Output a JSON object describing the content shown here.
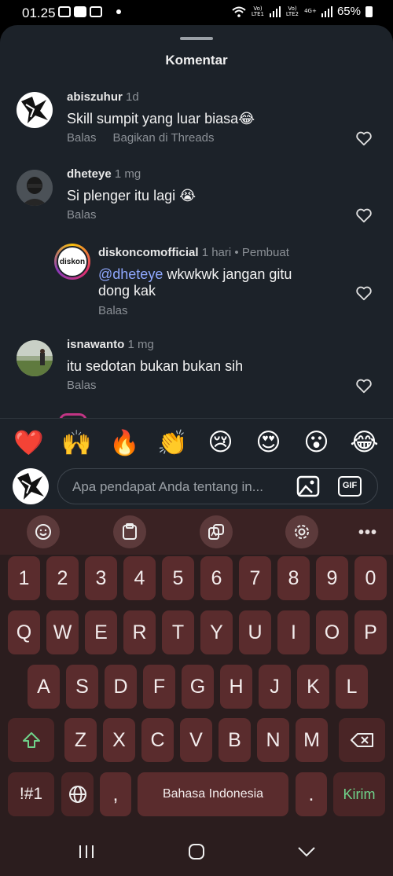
{
  "status_bar": {
    "time": "01.25",
    "battery": "65%",
    "sim1": "Vo) LTE1",
    "sim2": "Vo) LTE2",
    "net": "4G+"
  },
  "sheet": {
    "title": "Komentar"
  },
  "comments": [
    {
      "user": "abiszuhur",
      "time": "1d",
      "text": "Skill sumpit yang luar biasa😂",
      "actions": [
        "Balas",
        "Bagikan di Threads"
      ]
    },
    {
      "user": "dheteye",
      "time": "1 mg",
      "text": "Si plenger itu lagi 😭",
      "actions": [
        "Balas"
      ]
    },
    {
      "user": "diskoncomofficial",
      "time": "1 hari",
      "badge": "Pembuat",
      "mention": "@dheteye",
      "text_line1": " wkwkwk jangan gitu",
      "text_line2": "dong kak",
      "actions": [
        "Balas"
      ]
    },
    {
      "user": "isnawanto",
      "time": "1 mg",
      "text": "itu sedotan bukan bukan sih",
      "actions": [
        "Balas"
      ]
    }
  ],
  "avatar_logo_text": "diskon",
  "emojis": [
    "❤️",
    "🙌",
    "🔥",
    "👏",
    "😢",
    "😍",
    "😮",
    "😂"
  ],
  "input": {
    "placeholder": "Apa pendapat Anda tentang in...",
    "gif_label": "GIF"
  },
  "keyboard": {
    "toolbar": [
      "emoji-icon",
      "clipboard-icon",
      "translate-icon",
      "settings-icon",
      "more-icon"
    ],
    "more_label": "•••",
    "row_numbers": [
      "1",
      "2",
      "3",
      "4",
      "5",
      "6",
      "7",
      "8",
      "9",
      "0"
    ],
    "row_q": [
      "Q",
      "W",
      "E",
      "R",
      "T",
      "Y",
      "U",
      "I",
      "O",
      "P"
    ],
    "row_a": [
      "A",
      "S",
      "D",
      "F",
      "G",
      "H",
      "J",
      "K",
      "L"
    ],
    "row_z": [
      "Z",
      "X",
      "C",
      "V",
      "B",
      "N",
      "M"
    ],
    "symbols_label": "!#1",
    "comma": ",",
    "space_label": "Bahasa Indonesia",
    "period": ".",
    "send_label": "Kirim"
  },
  "colors": {
    "sheet_bg": "#1c2229",
    "mention": "#8fa8ff",
    "key_bg": "#5a2c2d",
    "keyboard_bg": "#2b1d1e",
    "send": "#6fd38a"
  }
}
